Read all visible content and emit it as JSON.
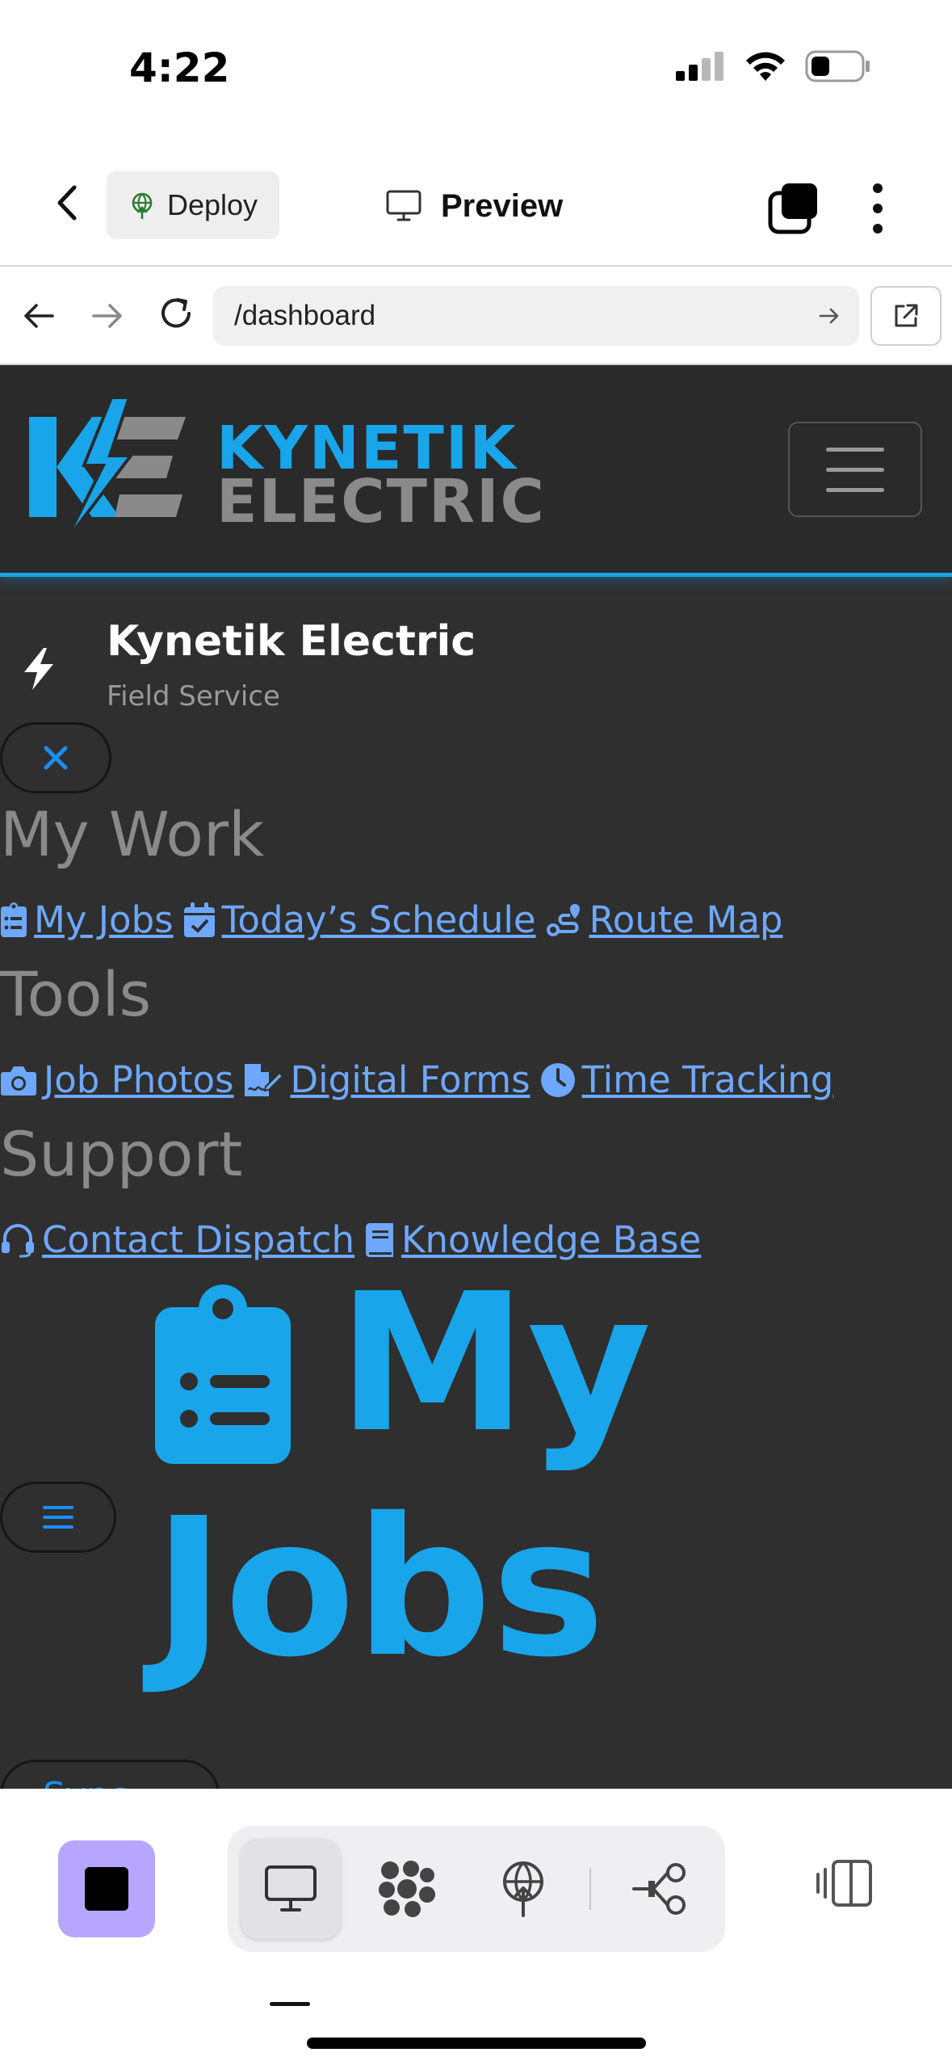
{
  "status_bar": {
    "time": "4:22",
    "signal_icon": "cellular-signal-icon",
    "wifi_icon": "wifi-icon",
    "battery_icon": "battery-low-icon"
  },
  "topnav": {
    "back_icon": "chevron-left-icon",
    "deploy_label": "Deploy",
    "deploy_icon": "globe-deploy-icon",
    "preview_label": "Preview",
    "preview_icon": "monitor-icon",
    "tabs_icon": "tabs-stack-icon",
    "more_icon": "more-vertical-icon"
  },
  "urlbar": {
    "url": "/dashboard",
    "back_icon": "arrow-left-icon",
    "forward_icon": "arrow-right-icon",
    "reload_icon": "reload-icon",
    "go_icon": "arrow-right-icon",
    "external_icon": "external-link-icon"
  },
  "app": {
    "brand_line1": "KYNETIK",
    "brand_line2": "ELECTRIC",
    "sidebar_title": "Kynetik Electric",
    "sidebar_subtitle": "Field Service",
    "sections": [
      {
        "heading": "My Work",
        "links": [
          {
            "label": "My Jobs",
            "icon": "clipboard-list-icon"
          },
          {
            "label": "Today’s Schedule",
            "icon": "calendar-check-icon"
          },
          {
            "label": "Route Map",
            "icon": "route-icon"
          }
        ]
      },
      {
        "heading": "Tools",
        "links": [
          {
            "label": "Job Photos",
            "icon": "camera-icon"
          },
          {
            "label": "Digital Forms",
            "icon": "file-signature-icon"
          },
          {
            "label": "Time Tracking",
            "icon": "clock-icon"
          }
        ]
      },
      {
        "heading": "Support",
        "links": [
          {
            "label": "Contact Dispatch",
            "icon": "headset-icon"
          },
          {
            "label": "Knowledge Base",
            "icon": "book-icon"
          }
        ]
      }
    ],
    "page_title_line1": "My",
    "page_title_line2": "Jobs",
    "sync_label": "Sync",
    "colors": {
      "accent": "#19a5ea",
      "link": "#6ea8fe",
      "app_bg": "#2f2f2f",
      "heading_gray": "#8a8a8a"
    }
  },
  "bottom_bar": {
    "stop_icon": "stop-icon",
    "modes": [
      {
        "name": "preview",
        "icon": "monitor-icon",
        "active": true
      },
      {
        "name": "workflow",
        "icon": "cluster-nodes-icon",
        "active": false
      },
      {
        "name": "deploy",
        "icon": "globe-deploy-icon",
        "active": false
      },
      {
        "name": "integrations",
        "icon": "connect-nodes-icon",
        "active": false
      }
    ],
    "panel_icon": "side-panel-icon",
    "stop_color": "#b7a6ff"
  }
}
